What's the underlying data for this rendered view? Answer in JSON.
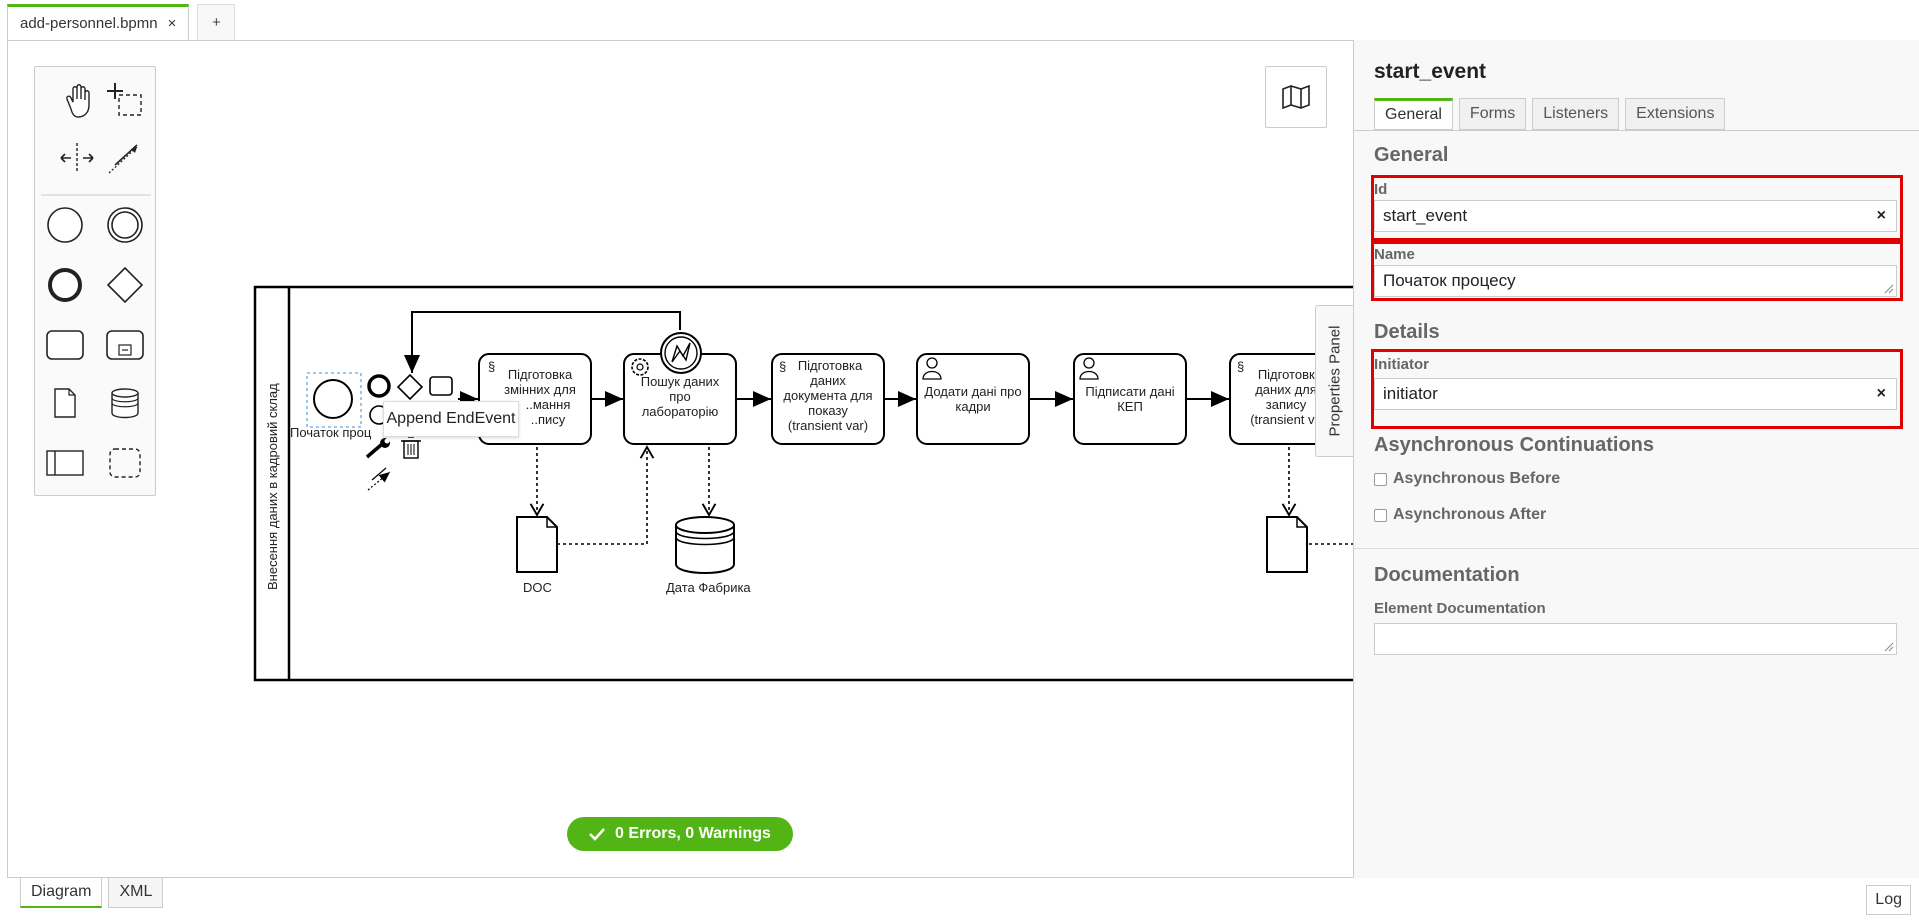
{
  "file_tab": {
    "name": "add-personnel.bpmn",
    "close": "×",
    "add": "+"
  },
  "palette": {
    "tools": [
      "hand-tool",
      "lasso-tool",
      "space-tool",
      "connect-tool"
    ],
    "shapes": [
      "start-event",
      "intermediate-event",
      "end-event",
      "gateway",
      "task",
      "subprocess",
      "data-object",
      "data-store",
      "pool",
      "group"
    ]
  },
  "diagram": {
    "pool_label": "Внесення даних в кадровий склад",
    "start_event_label": "Початок проц",
    "tasks": [
      {
        "text": [
          "Підготовка",
          "змінних для",
          "..мання",
          "..пису"
        ],
        "type": "script"
      },
      {
        "text": [
          "Пошук даних",
          "про",
          "лабораторію"
        ],
        "type": "service"
      },
      {
        "text": [
          "Підготовка",
          "даних",
          "документа для",
          "показу",
          "(transient var)"
        ],
        "type": "script"
      },
      {
        "text": [
          "Додати дані про",
          "кадри"
        ],
        "type": "user"
      },
      {
        "text": [
          "Підписати дані",
          "КЕП"
        ],
        "type": "user"
      },
      {
        "text": [
          "Підготовка",
          "даних для",
          "запису",
          "(transient va"
        ],
        "type": "script"
      }
    ],
    "data_object_label": "DOC",
    "data_store_label": "Дата Фабрика",
    "tooltip": "Append EndEvent"
  },
  "status": {
    "text": "0 Errors, 0 Warnings"
  },
  "side_tab": {
    "label": "Properties Panel"
  },
  "properties": {
    "title": "start_event",
    "tabs": [
      "General",
      "Forms",
      "Listeners",
      "Extensions"
    ],
    "general_section": "General",
    "id_label": "Id",
    "id_value": "start_event",
    "name_label": "Name",
    "name_value": "Початок процесу",
    "details_section": "Details",
    "initiator_label": "Initiator",
    "initiator_value": "initiator",
    "async_section": "Asynchronous Continuations",
    "async_before": "Asynchronous Before",
    "async_after": "Asynchronous After",
    "doc_section": "Documentation",
    "doc_label": "Element Documentation",
    "doc_value": "",
    "clear": "×"
  },
  "bottom_tabs": [
    "Diagram",
    "XML"
  ],
  "log_label": "Log",
  "colors": {
    "accent": "#52b415",
    "highlight": "#e00000"
  }
}
